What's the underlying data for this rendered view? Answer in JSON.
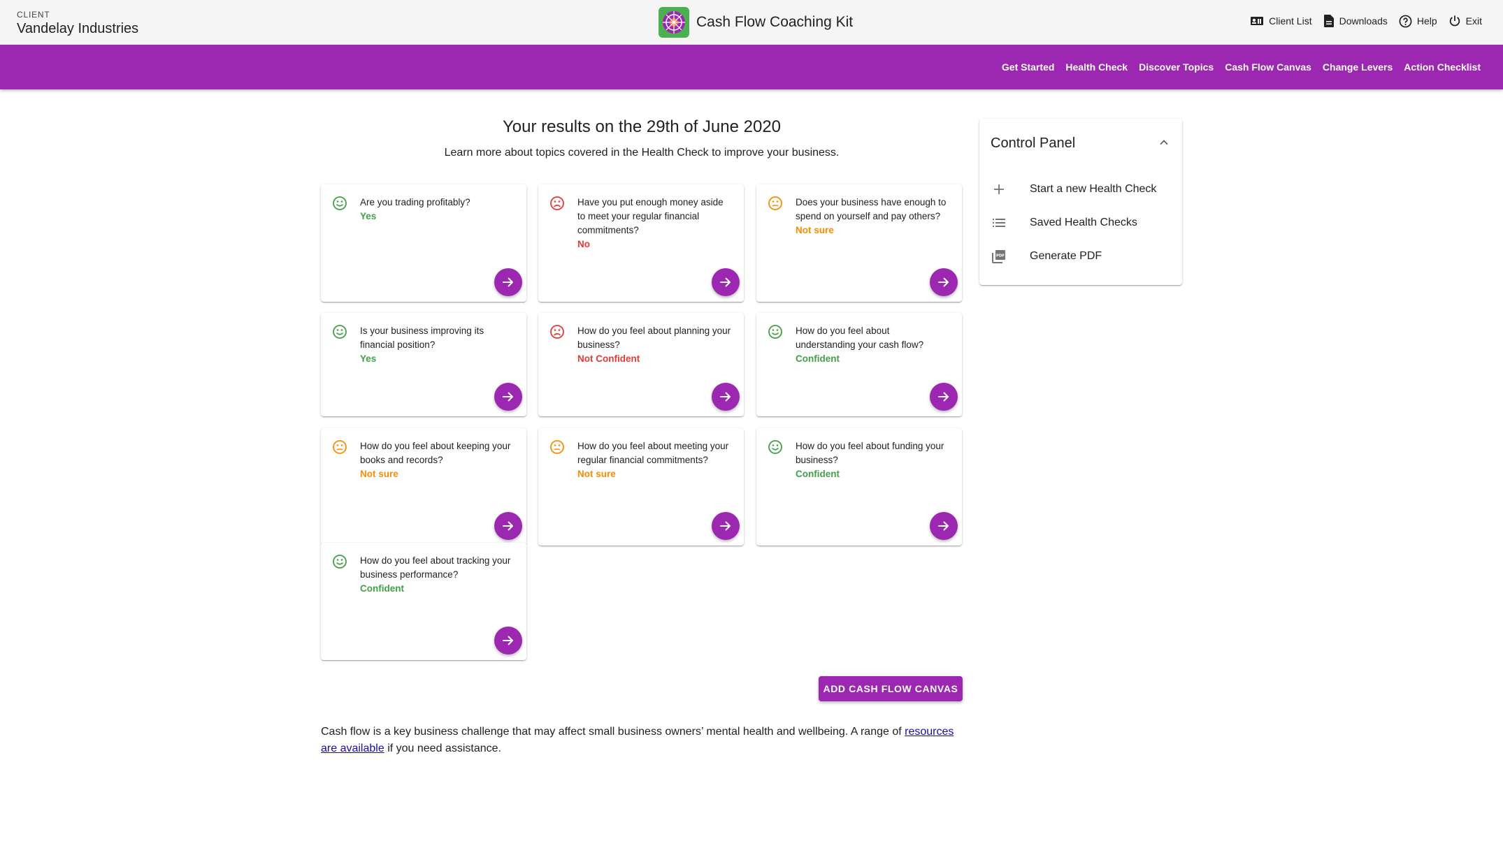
{
  "header": {
    "client_label": "CLIENT",
    "client_name": "Vandelay Industries",
    "app_title": "Cash Flow Coaching Kit",
    "util_nav": [
      {
        "label": "Client List",
        "icon": "contacts-icon"
      },
      {
        "label": "Downloads",
        "icon": "document-icon"
      },
      {
        "label": "Help",
        "icon": "help-icon"
      },
      {
        "label": "Exit",
        "icon": "power-icon"
      }
    ]
  },
  "main_nav": [
    "Get Started",
    "Health Check",
    "Discover Topics",
    "Cash Flow Canvas",
    "Change Levers",
    "Action Checklist"
  ],
  "results": {
    "title": "Your results on the 29th of June 2020",
    "subtitle": "Learn more about topics covered in the Health Check to improve your business."
  },
  "colors": {
    "purple": "#9c27b0",
    "green": "#43a047",
    "red": "#e53935",
    "orange": "#fb8c00"
  },
  "cards": [
    {
      "question": "Are you trading profitably?",
      "answer": "Yes",
      "mood": "happy"
    },
    {
      "question": "Have you put enough money aside to meet your regular financial commitments?",
      "answer": "No",
      "mood": "sad"
    },
    {
      "question": "Does your business have enough to spend on yourself and pay others?",
      "answer": "Not sure",
      "mood": "neutral"
    },
    {
      "question": "Is your business improving its financial position?",
      "answer": "Yes",
      "mood": "happy"
    },
    {
      "question": "How do you feel about planning your business?",
      "answer": "Not Confident",
      "mood": "sad"
    },
    {
      "question": "How do you feel about understanding your cash flow?",
      "answer": "Confident",
      "mood": "happy"
    },
    {
      "question": "How do you feel about keeping your books and records?",
      "answer": "Not sure",
      "mood": "neutral"
    },
    {
      "question": "How do you feel about meeting your regular financial commitments?",
      "answer": "Not sure",
      "mood": "neutral"
    },
    {
      "question": "How do you feel about funding your business?",
      "answer": "Confident",
      "mood": "happy"
    },
    {
      "question": "How do you feel about tracking your business performance?",
      "answer": "Confident",
      "mood": "happy"
    }
  ],
  "add_canvas_label": "ADD CASH FLOW CANVAS",
  "footer": {
    "text_before": "Cash flow is a key business challenge that may affect small business owners’ mental health and wellbeing. A range of",
    "link_text": "resources are available",
    "text_after": "if you need assistance."
  },
  "control_panel": {
    "title": "Control Panel",
    "items": [
      {
        "label": "Start a new Health Check",
        "icon": "plus-icon"
      },
      {
        "label": "Saved Health Checks",
        "icon": "list-icon"
      },
      {
        "label": "Generate PDF",
        "icon": "pdf-icon"
      }
    ]
  }
}
